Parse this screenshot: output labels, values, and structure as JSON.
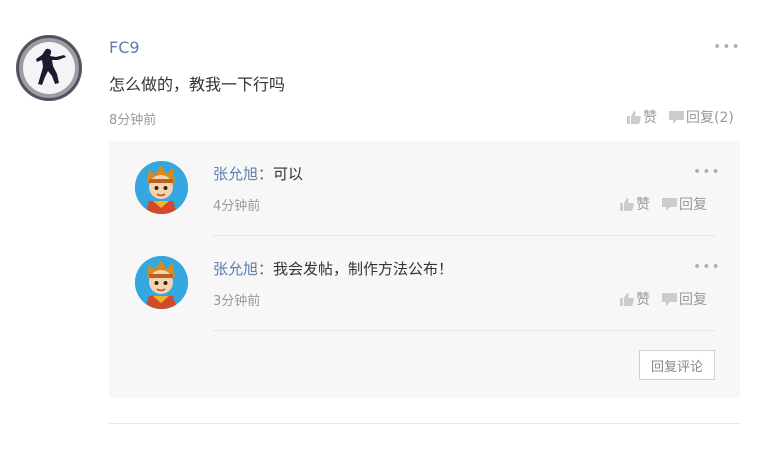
{
  "comment": {
    "username": "FC9",
    "text": "怎么做的，教我一下行吗",
    "time": "8分钟前",
    "more": "•••",
    "like_label": "赞",
    "reply_label": "回复(2)"
  },
  "replies": [
    {
      "name": "张允旭",
      "sep": "：",
      "content": "可以",
      "time": "4分钟前",
      "more": "•••",
      "like_label": "赞",
      "reply_label": "回复"
    },
    {
      "name": "张允旭",
      "sep": "：",
      "content": "我会发帖，制作方法公布！",
      "time": "3分钟前",
      "more": "•••",
      "like_label": "赞",
      "reply_label": "回复"
    }
  ],
  "reply_comment_button": "回复评论",
  "icons": {
    "like": "thumbs-up-icon",
    "reply": "comment-bubble-icon",
    "more": "more-dots-icon"
  },
  "colors": {
    "username": "#5b7fae",
    "meta": "#999999",
    "reply_bg": "#f7f7f7"
  }
}
